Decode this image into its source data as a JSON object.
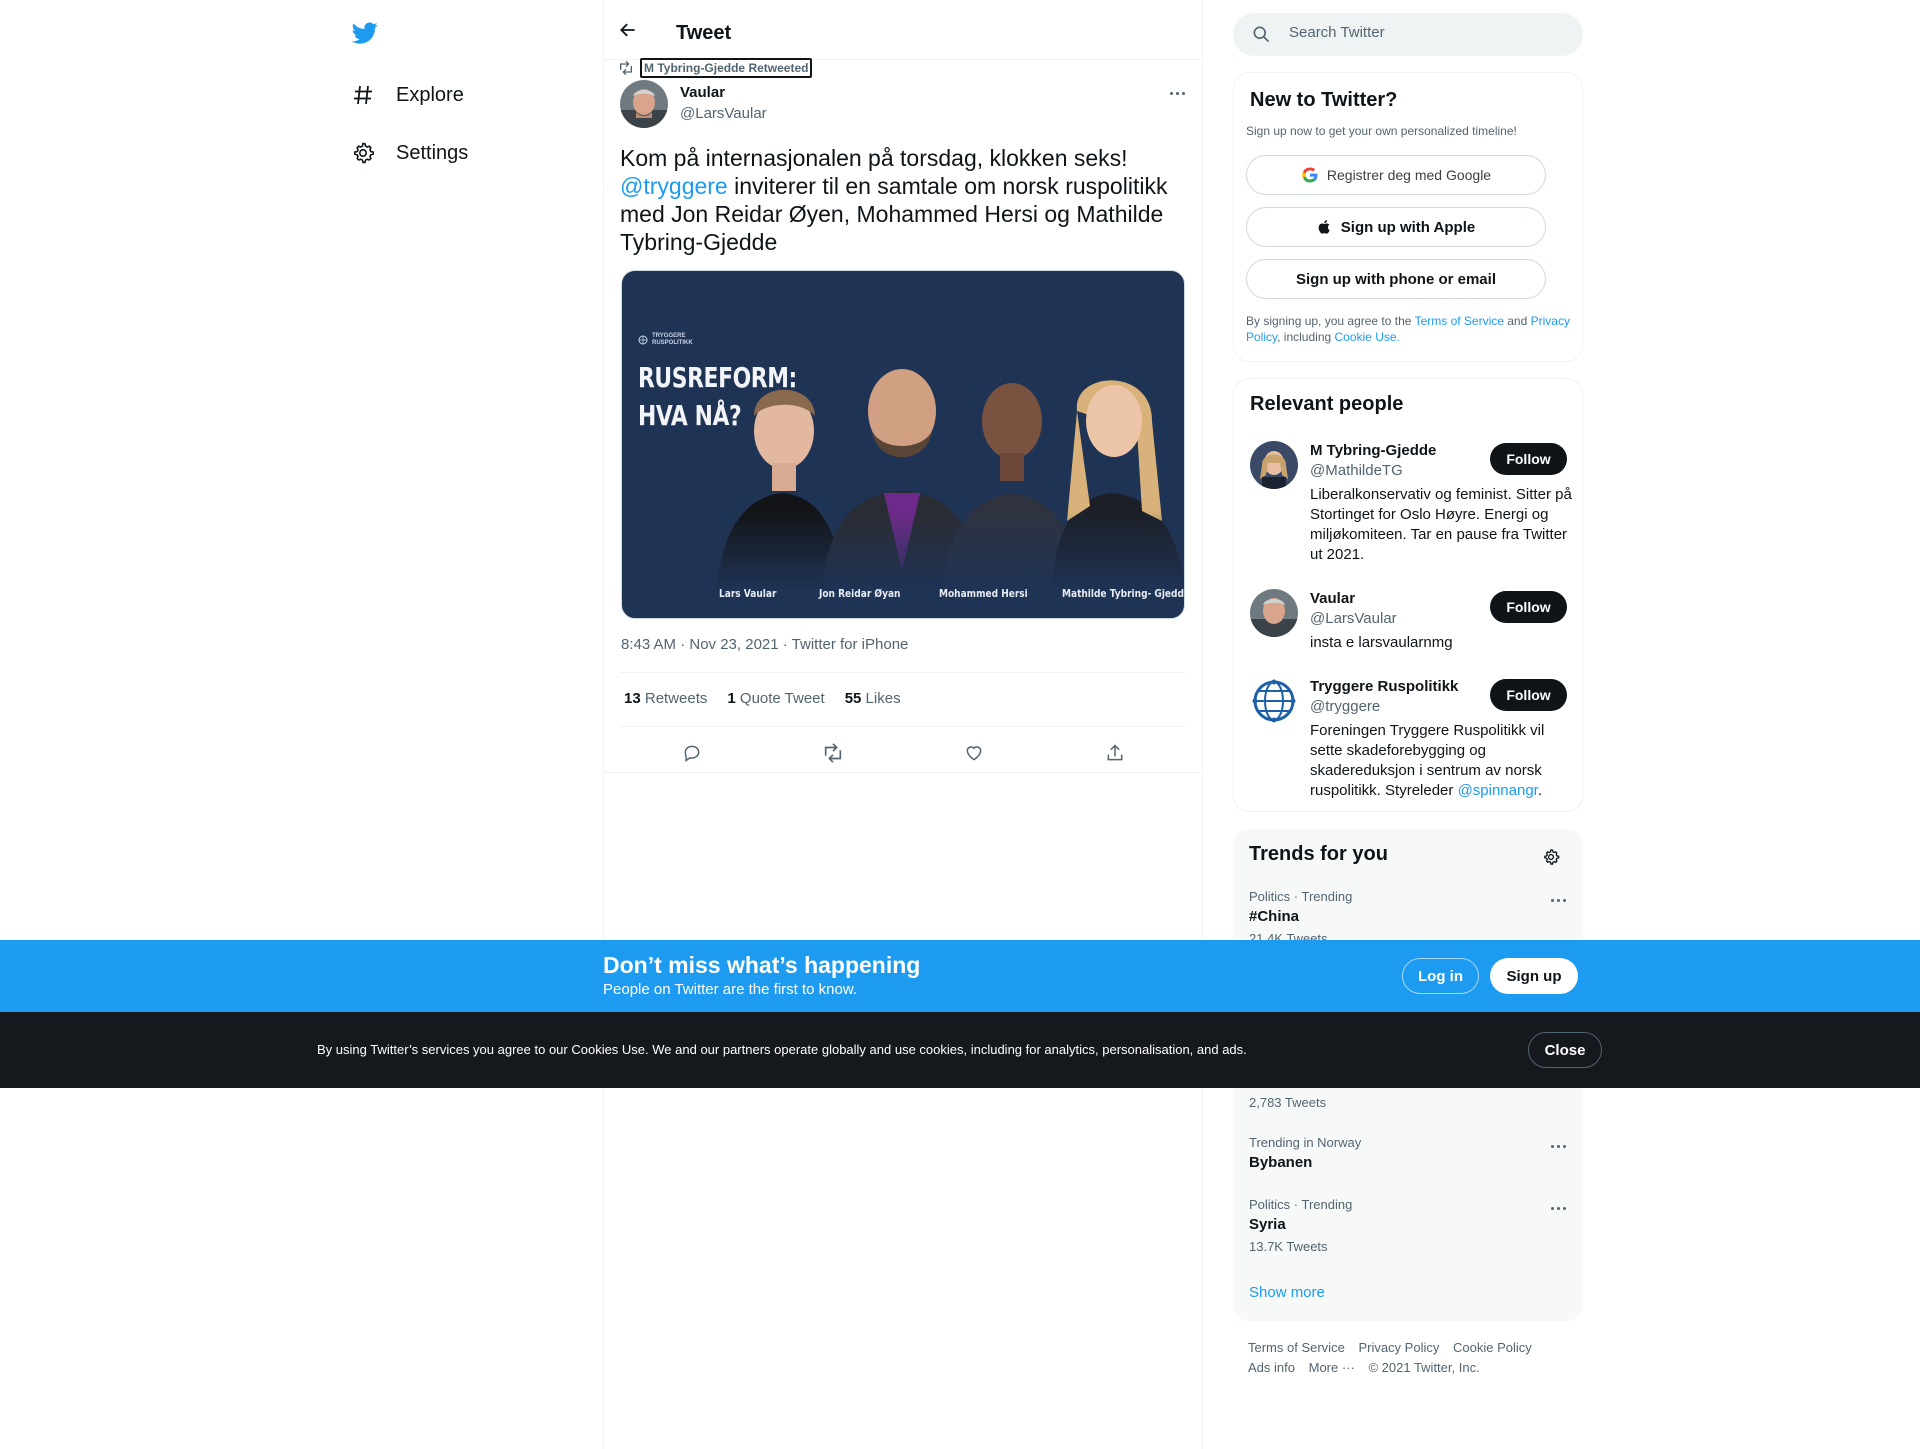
{
  "nav": {
    "items": [
      {
        "label": "Explore",
        "icon": "hashtag-icon"
      },
      {
        "label": "Settings",
        "icon": "gear-icon"
      }
    ]
  },
  "header": {
    "title": "Tweet"
  },
  "tweet": {
    "retweeted_by": "M Tybring-Gjedde Retweeted",
    "author_name": "Vaular",
    "author_handle": "@LarsVaular",
    "text_before": "Kom på internasjonalen på torsdag, klokken seks!",
    "mention": "@tryggere",
    "text_after": " inviterer til en samtale om norsk ruspolitikk med Jon Reidar Øyen, Mohammed Hersi og Mathilde Tybring-Gjedde",
    "media": {
      "brand_line1": "TRYGGERE",
      "brand_line2": "RUSPOLITIKK",
      "headline_line1": "RUSREFORM:",
      "headline_line2": "HVA NÅ?",
      "people": [
        "Lars Vaular",
        "Jon Reidar Øyan",
        "Mohammed Hersi",
        "Mathilde Tybring- Gjedde"
      ]
    },
    "timestamp": "8:43 AM · Nov 23, 2021 · Twitter for iPhone",
    "stats": {
      "retweets_count": "13",
      "retweets_label": "Retweets",
      "quotes_count": "1",
      "quotes_label": "Quote Tweet",
      "likes_count": "55",
      "likes_label": "Likes"
    }
  },
  "search": {
    "placeholder": "Search Twitter"
  },
  "signup_card": {
    "title": "New to Twitter?",
    "subtitle": "Sign up now to get your own personalized timeline!",
    "google_label": "Registrer deg med Google",
    "apple_label": "Sign up with Apple",
    "phone_label": "Sign up with phone or email",
    "legal_1": "By signing up, you agree to the ",
    "terms": "Terms of Service",
    "legal_2": " and ",
    "privacy": "Privacy Policy",
    "legal_3": ", including ",
    "cookie": "Cookie Use."
  },
  "people_card": {
    "title": "Relevant people",
    "follow_label": "Follow",
    "people": [
      {
        "name": "M Tybring-Gjedde",
        "handle": "@MathildeTG",
        "bio": "Liberalkonservativ og feminist. Sitter på Stortinget for Oslo Høyre. Energi og miljøkomiteen. Tar en pause fra Twitter ut 2021."
      },
      {
        "name": "Vaular",
        "handle": "@LarsVaular",
        "bio": "insta e larsvaularnmg"
      },
      {
        "name": "Tryggere Ruspolitikk",
        "handle": "@tryggere",
        "bio": "Foreningen Tryggere Ruspolitikk vil sette skadeforebygging og skadereduksjon i sentrum av norsk ruspolitikk. Styreleder ",
        "bio_mention": "@spinnangr",
        "bio_end": "."
      }
    ]
  },
  "trends_card": {
    "title": "Trends for you",
    "trends": [
      {
        "meta": "Politics · Trending",
        "name": "#China",
        "count": "21.4K Tweets"
      },
      {
        "meta": "",
        "name": "",
        "count": "2,783 Tweets"
      },
      {
        "meta": "Trending in Norway",
        "name": "Bybanen",
        "count": ""
      },
      {
        "meta": "Politics · Trending",
        "name": "Syria",
        "count": "13.7K Tweets"
      }
    ],
    "show_more": "Show more"
  },
  "footer": {
    "links": [
      "Terms of Service",
      "Privacy Policy",
      "Cookie Policy",
      "Ads info",
      "More ···"
    ],
    "copyright": "© 2021 Twitter, Inc."
  },
  "banner": {
    "headline": "Don’t miss what’s happening",
    "subline": "People on Twitter are the first to know.",
    "login": "Log in",
    "signup": "Sign up"
  },
  "cookie_bar": {
    "text": "By using Twitter’s services you agree to our Cookies Use. We and our partners operate globally and use cookies, including for analytics, personalisation, and ads.",
    "close": "Close"
  },
  "colors": {
    "accent": "#1d9bf0",
    "text": "#0f1419",
    "muted": "#536471",
    "dark_bar": "#15181c",
    "media_bg": "#1f3355"
  }
}
